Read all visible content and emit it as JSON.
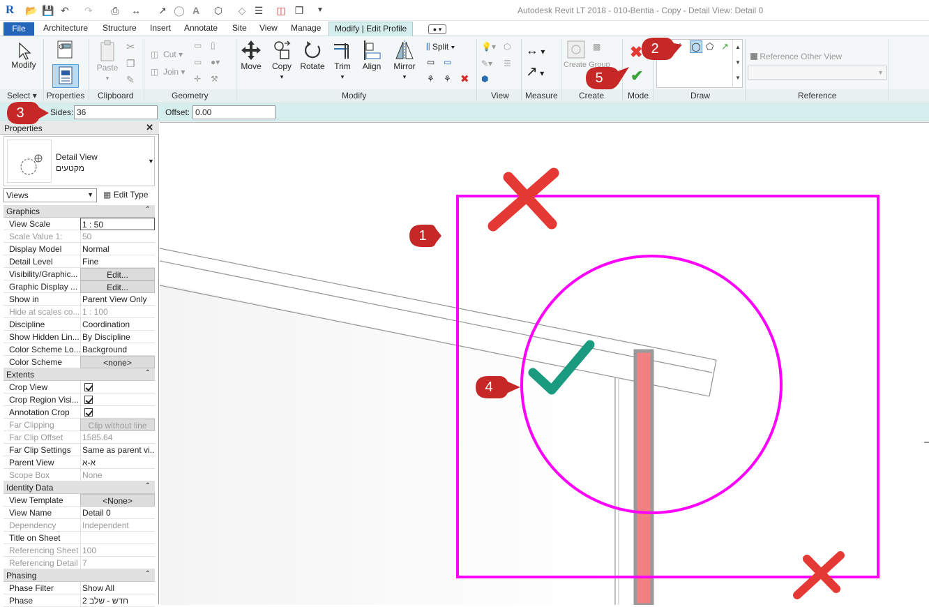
{
  "titlebar": {
    "logo": "R",
    "title": "Autodesk Revit LT 2018 -     010-Bentia - Copy - Detail View: Detail 0"
  },
  "tabs": {
    "file": "File",
    "architecture": "Architecture",
    "structure": "Structure",
    "insert": "Insert",
    "annotate": "Annotate",
    "site": "Site",
    "view": "View",
    "manage": "Manage",
    "modify_profile": "Modify | Edit Profile"
  },
  "ribbon": {
    "select": {
      "modify": "Modify",
      "label": "Select"
    },
    "properties": {
      "label": "Properties"
    },
    "clipboard": {
      "paste": "Paste",
      "cut": "Cut",
      "join": "Join",
      "label": "Clipboard"
    },
    "geometry": {
      "label": "Geometry"
    },
    "modify": {
      "move": "Move",
      "copy": "Copy",
      "rotate": "Rotate",
      "trim": "Trim",
      "align": "Align",
      "mirror": "Mirror",
      "split": "Split",
      "label": "Modify"
    },
    "view": {
      "label": "View"
    },
    "measure": {
      "label": "Measure"
    },
    "create": {
      "create_group": "Create Group",
      "label": "Create"
    },
    "mode": {
      "label": "Mode"
    },
    "draw": {
      "label": "Draw"
    },
    "reference": {
      "reference_other_view": "Reference Other View",
      "label": "Reference"
    }
  },
  "options_bar": {
    "sides_label": "Sides:",
    "sides_value": "36",
    "offset_label": "Offset:",
    "offset_value": "0.00"
  },
  "properties": {
    "header": "Properties",
    "type_name": "Detail View",
    "type_subname": "מקטעים",
    "views_select": "Views",
    "edit_type": "Edit Type",
    "sections": {
      "graphics": "Graphics",
      "extents": "Extents",
      "identity": "Identity Data",
      "phasing": "Phasing"
    },
    "graphics_rows": [
      {
        "name": "View Scale",
        "value": "1 : 50"
      },
      {
        "name": "Scale Value    1:",
        "value": "50"
      },
      {
        "name": "Display Model",
        "value": "Normal"
      },
      {
        "name": "Detail Level",
        "value": "Fine"
      },
      {
        "name": "Visibility/Graphic...",
        "value": "Edit..."
      },
      {
        "name": "Graphic Display ...",
        "value": "Edit..."
      },
      {
        "name": "Show in",
        "value": "Parent View Only"
      },
      {
        "name": "Hide at scales co...",
        "value": "1 : 100"
      },
      {
        "name": "Discipline",
        "value": "Coordination"
      },
      {
        "name": "Show Hidden Lin...",
        "value": "By Discipline"
      },
      {
        "name": "Color Scheme Lo...",
        "value": "Background"
      },
      {
        "name": "Color Scheme",
        "value": "<none>"
      }
    ],
    "extents_rows": [
      {
        "name": "Crop View",
        "value": ""
      },
      {
        "name": "Crop Region Visi...",
        "value": ""
      },
      {
        "name": "Annotation Crop",
        "value": ""
      },
      {
        "name": "Far Clipping",
        "value": "Clip without line"
      },
      {
        "name": "Far Clip Offset",
        "value": "1585.64"
      },
      {
        "name": "Far Clip Settings",
        "value": "Same as parent vi..."
      },
      {
        "name": "Parent View",
        "value": "א-א"
      },
      {
        "name": "Scope Box",
        "value": "None"
      }
    ],
    "identity_rows": [
      {
        "name": "View Template",
        "value": "<None>"
      },
      {
        "name": "View Name",
        "value": "Detail 0"
      },
      {
        "name": "Dependency",
        "value": "Independent"
      },
      {
        "name": "Title on Sheet",
        "value": ""
      },
      {
        "name": "Referencing Sheet",
        "value": "100"
      },
      {
        "name": "Referencing Detail",
        "value": "7"
      }
    ],
    "phasing_rows": [
      {
        "name": "Phase Filter",
        "value": "Show All"
      },
      {
        "name": "Phase",
        "value": "חדש - שלב 2"
      }
    ]
  },
  "callouts": [
    "1",
    "2",
    "3",
    "4",
    "5"
  ],
  "colors": {
    "callout": "#c62828",
    "highlight": "#ff00ff",
    "accept": "#1a9b80",
    "cancel": "#e53935",
    "file_tab": "#2566b8",
    "contextual_tab": "#d4eded",
    "column": "#f28080"
  }
}
